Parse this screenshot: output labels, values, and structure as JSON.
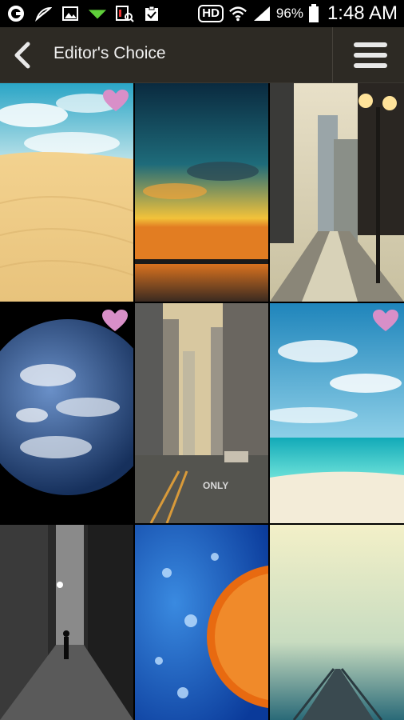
{
  "status_bar": {
    "hd_label": "HD",
    "battery_percent": "96%",
    "time": "1:48 AM",
    "icons": [
      "sync-icon",
      "leaf-icon",
      "image-icon",
      "download-icon",
      "screenshot-icon",
      "clipboard-check-icon",
      "wifi-icon",
      "signal-icon",
      "battery-icon"
    ]
  },
  "action_bar": {
    "title": "Editor's Choice",
    "back_icon": "back-arrow-icon",
    "menu_icon": "menu-icon"
  },
  "wallpapers": [
    {
      "name": "desert-dunes",
      "favorited": true
    },
    {
      "name": "sunset-lake",
      "favorited": false
    },
    {
      "name": "city-street-lamps",
      "favorited": false
    },
    {
      "name": "earth-globe",
      "favorited": true
    },
    {
      "name": "city-only-road",
      "favorited": false
    },
    {
      "name": "tropical-beach",
      "favorited": true
    },
    {
      "name": "dark-alley",
      "favorited": false
    },
    {
      "name": "orange-splash",
      "favorited": false
    },
    {
      "name": "pier-sea",
      "favorited": false
    }
  ],
  "colors": {
    "action_bar": "#2d2a24",
    "heart": "#d88fc8"
  }
}
